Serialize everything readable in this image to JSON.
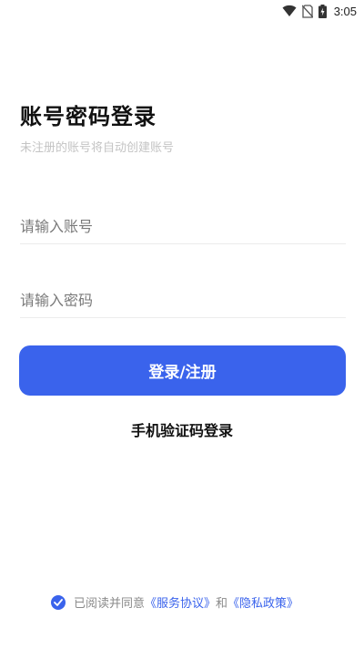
{
  "status_bar": {
    "time": "3:05",
    "icons": [
      "wifi-icon",
      "no-sim-icon",
      "battery-charging-icon"
    ]
  },
  "login": {
    "title": "账号密码登录",
    "subtitle": "未注册的账号将自动创建账号",
    "account_placeholder": "请输入账号",
    "password_placeholder": "请输入密码",
    "submit_label": "登录/注册",
    "sms_login_label": "手机验证码登录"
  },
  "agreement": {
    "checked": true,
    "prefix": "已阅读并同意",
    "service_link": "《服务协议》",
    "and": "和",
    "privacy_link": "《隐私政策》"
  },
  "colors": {
    "accent": "#3a63ec",
    "subtitle": "#c4c4c4",
    "placeholder": "#7a7a7a"
  }
}
